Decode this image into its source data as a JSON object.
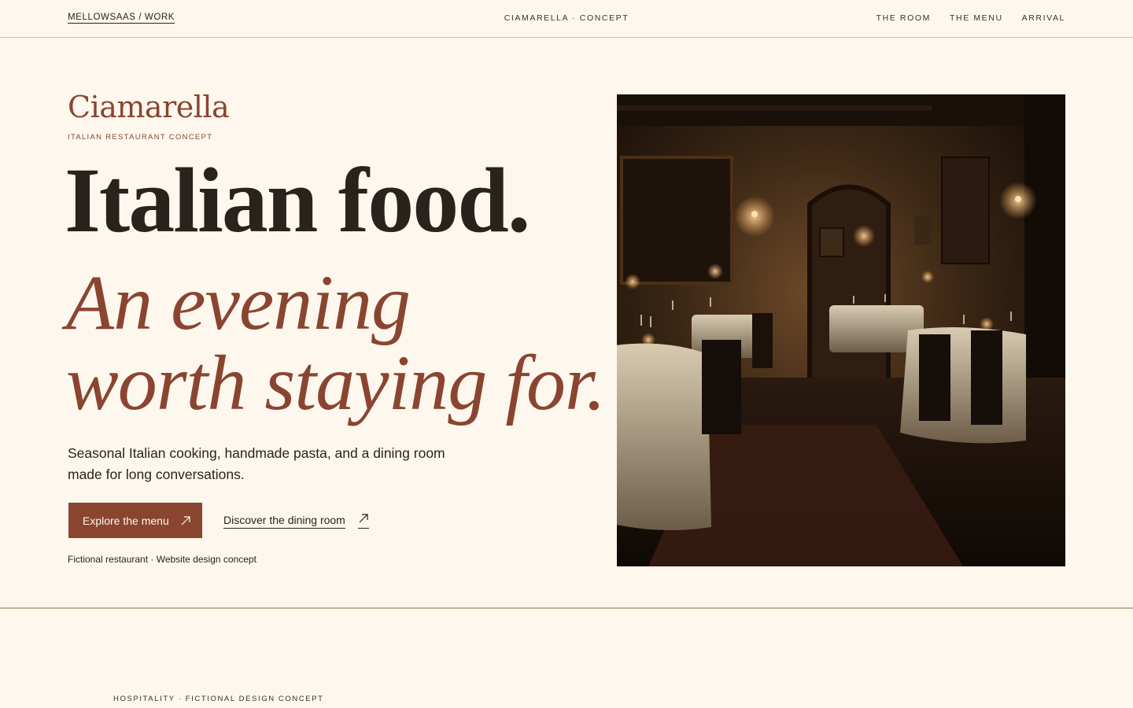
{
  "topbar": {
    "back_label": "MELLOWSAAS / WORK",
    "center_label": "CIAMARELLA · CONCEPT",
    "nav": [
      "THE ROOM",
      "THE MENU",
      "ARRIVAL"
    ]
  },
  "hero": {
    "brand": "Ciamarella",
    "brand_sub": "ITALIAN RESTAURANT CONCEPT",
    "headline": "Italian food.",
    "subhead_line1": "An evening",
    "subhead_line2": "worth staying for.",
    "lede": "Seasonal Italian cooking, handmade pasta, and a dining room made for long conversations.",
    "cta_primary": "Explore the menu",
    "cta_secondary": "Discover the dining room",
    "footnote": "Fictional restaurant · Website design concept"
  },
  "next_section": {
    "tag": "HOSPITALITY · FICTIONAL DESIGN CONCEPT"
  },
  "colors": {
    "background": "#fdf7ee",
    "accent": "#8a4530",
    "ink": "#2a231d"
  },
  "icons": {
    "cta_arrow": "arrow-up-right-icon"
  }
}
